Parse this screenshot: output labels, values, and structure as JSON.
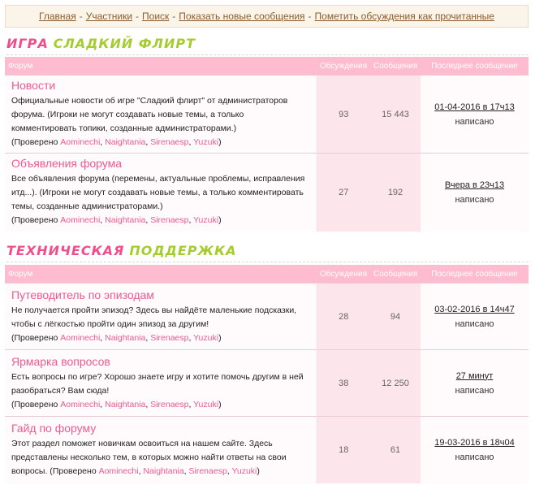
{
  "nav": {
    "items": [
      "Главная",
      "Участники",
      "Поиск",
      "Показать новые сообщения",
      "Пометить обсуждения как прочитанные"
    ],
    "separator": "-"
  },
  "headers": {
    "forum": "Форум",
    "topics": "Обсуждения",
    "posts": "Сообщения",
    "last": "Последнее сообщение"
  },
  "moderated_label": "Проверено",
  "moderators": [
    "Aominechi",
    "Naightania",
    "Sirenaesp",
    "Yuzuki"
  ],
  "categories": [
    {
      "title_word1": "Игра",
      "title_word2": "Сладкий флирт",
      "forums": [
        {
          "title": "Новости",
          "desc": "Официальные новости об игре \"Сладкий флирт\" от администраторов форума. (Игроки не могут создавать новые темы, а только комментировать топики, созданные администраторами.)",
          "topics": "93",
          "posts": "15 443",
          "last_date": "01-04-2016 в 17ч13",
          "last_by": "написано"
        },
        {
          "title": "Объявления форума",
          "desc": "Все объявления форума (перемены, актуальные проблемы, исправления итд...). (Игроки не могут создавать новые темы, а только комментировать темы, созданные администраторами.)",
          "topics": "27",
          "posts": "192",
          "last_date": "Вчера в 23ч13",
          "last_by": "написано"
        }
      ]
    },
    {
      "title_word1": "Техническая",
      "title_word2": "поддержка",
      "forums": [
        {
          "title": "Путеводитель по эпизодам",
          "desc": "Не получается пройти эпизод? Здесь вы найдёте маленькие подсказки, чтобы с лёгкостью пройти один эпизод за другим!",
          "topics": "28",
          "posts": "94",
          "last_date": "03-02-2016 в 14ч47",
          "last_by": "написано"
        },
        {
          "title": "Ярмарка вопросов",
          "desc": "Есть вопросы по игре? Хорошо знаете игру и хотите помочь другим в ней разобраться? Вам сюда!",
          "topics": "38",
          "posts": "12 250",
          "last_date": "27 минут",
          "last_by": "написано"
        },
        {
          "title": "Гайд по форуму",
          "desc": "Этот раздел поможет новичкам освоиться на нашем сайте. Здесь представлены несколько тем, в которых можно найти ответы на свои вопросы.",
          "topics": "18",
          "posts": "61",
          "last_date": "19-03-2016 в 18ч04",
          "last_by": "написано"
        }
      ]
    }
  ]
}
